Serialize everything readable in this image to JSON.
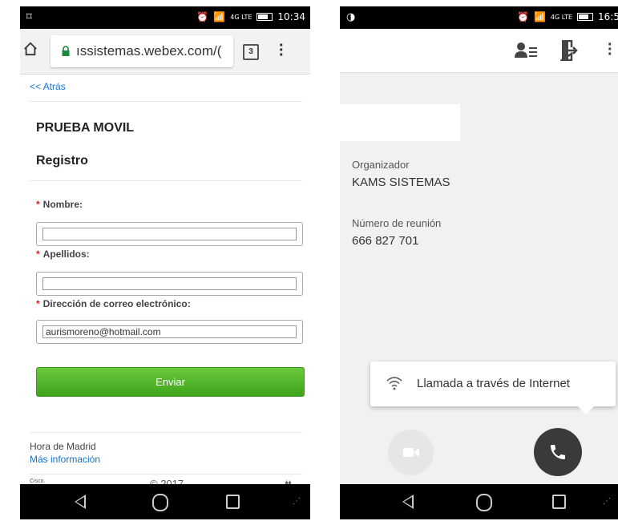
{
  "left_phone": {
    "status": {
      "time": "10:34",
      "network": "4G LTE"
    },
    "browser": {
      "url": "ıssistemas.webex.com/(",
      "tab_count": "3"
    },
    "page": {
      "back_link": "<< Atrás",
      "title": "PRUEBA MOVIL",
      "subtitle": "Registro",
      "fields": [
        {
          "required": "*",
          "label": "Nombre:",
          "value": ""
        },
        {
          "required": "*",
          "label": "Apellidos:",
          "value": ""
        },
        {
          "required": "*",
          "label": "Dirección de correo electrónico:",
          "value": "aurismoreno@hotmail.com"
        }
      ],
      "submit_label": "Enviar",
      "timezone": "Hora de Madrid",
      "more_info": "Más información",
      "cisco_label": "Cisco.",
      "copyright": "© 2017",
      "cisco_logo": "ılıılı"
    }
  },
  "right_phone": {
    "status": {
      "time": "16:5",
      "network": "4G LTE"
    },
    "meeting": {
      "host_label": "Organizador",
      "host_value": "KAMS SISTEMAS",
      "number_label": "Número de reunión",
      "number_value": "666 827 701"
    },
    "tooltip": {
      "text": "Llamada a través de Internet"
    }
  },
  "colors": {
    "link": "#1a73c7",
    "button_green": "#4cb326",
    "required": "#d22222",
    "call_button": "#3a3a3a"
  }
}
